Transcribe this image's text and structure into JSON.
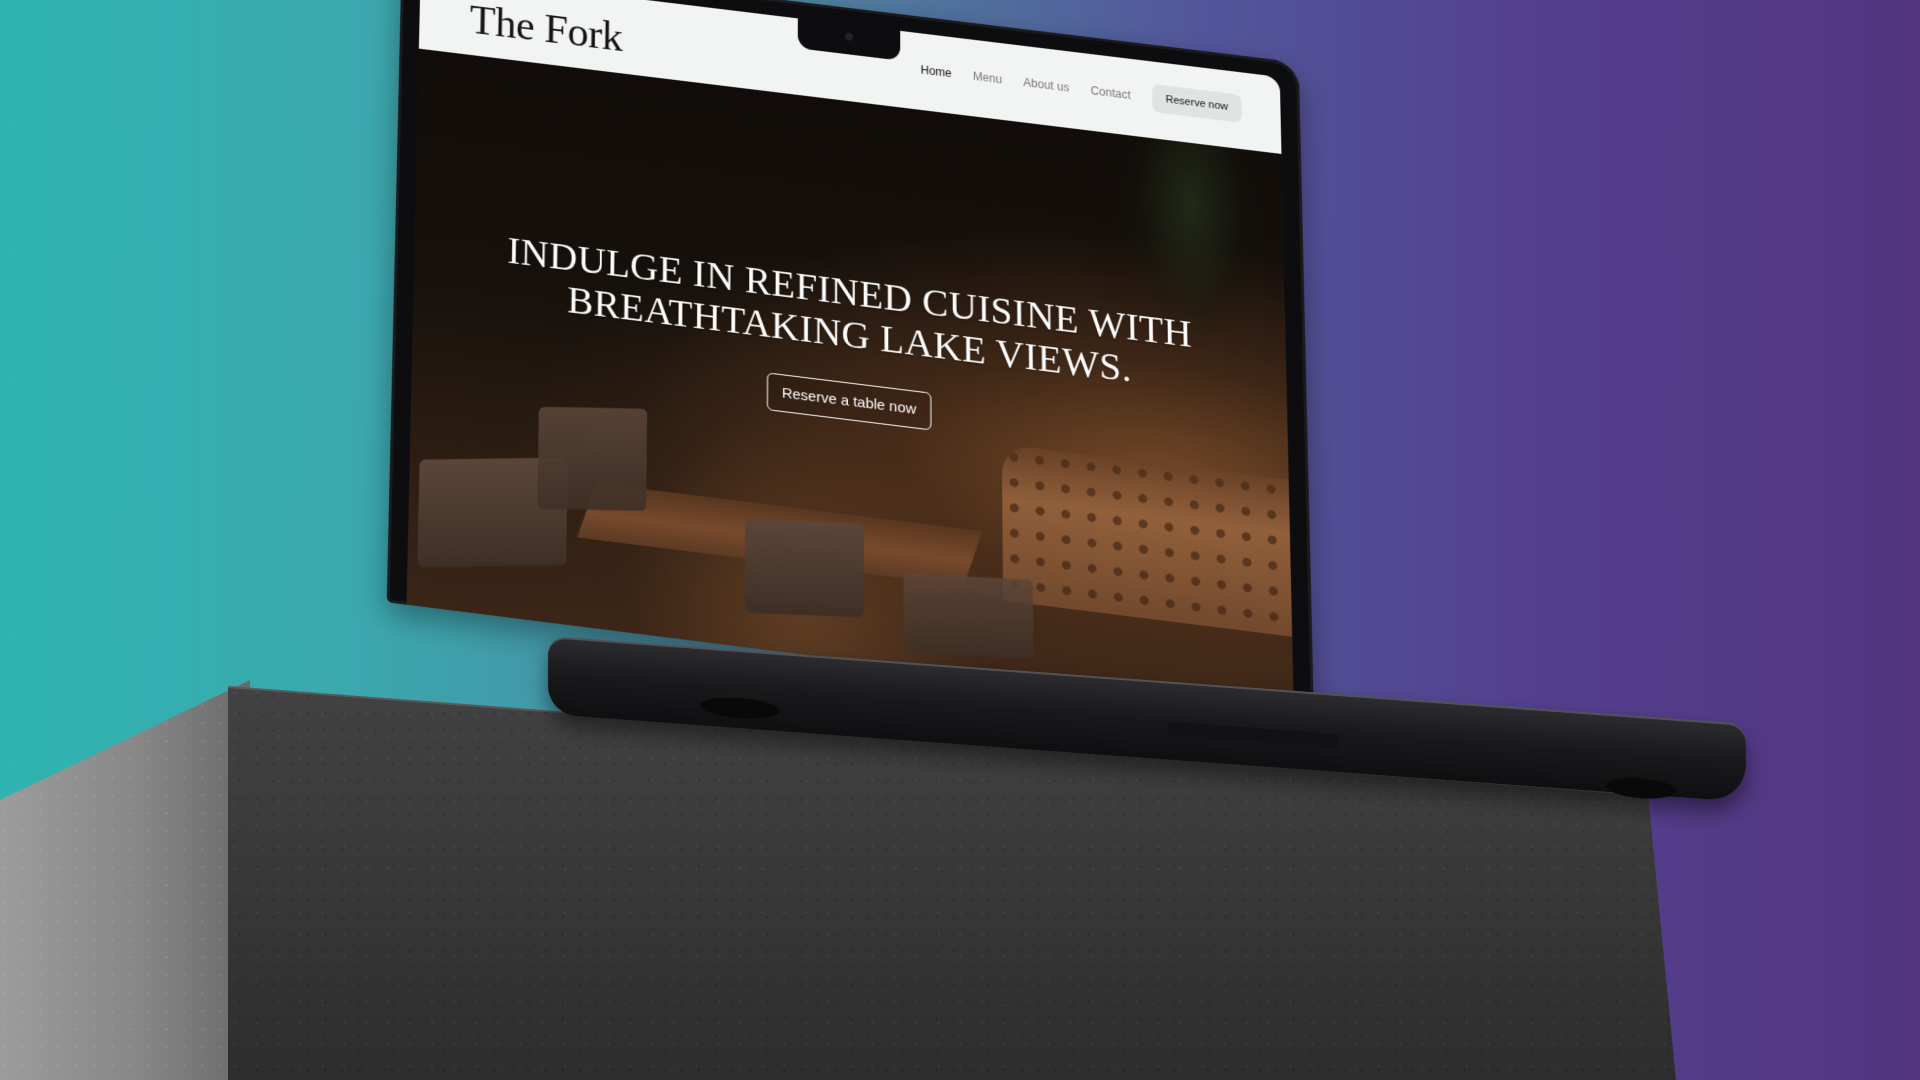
{
  "site": {
    "logo": "The Fork",
    "nav": [
      {
        "label": "Home",
        "active": true
      },
      {
        "label": "Menu",
        "active": false
      },
      {
        "label": "About us",
        "active": false
      },
      {
        "label": "Contact",
        "active": false
      }
    ],
    "cta": "Reserve now"
  },
  "hero": {
    "headline": "INDULGE IN REFINED CUISINE WITH BREATHTAKING LAKE VIEWS.",
    "button": "Reserve a table now"
  },
  "colors": {
    "background_left": "#2fb3b1",
    "background_right": "#53357f",
    "header_bg": "#f2f4f3",
    "hero_text": "#ffffff"
  }
}
